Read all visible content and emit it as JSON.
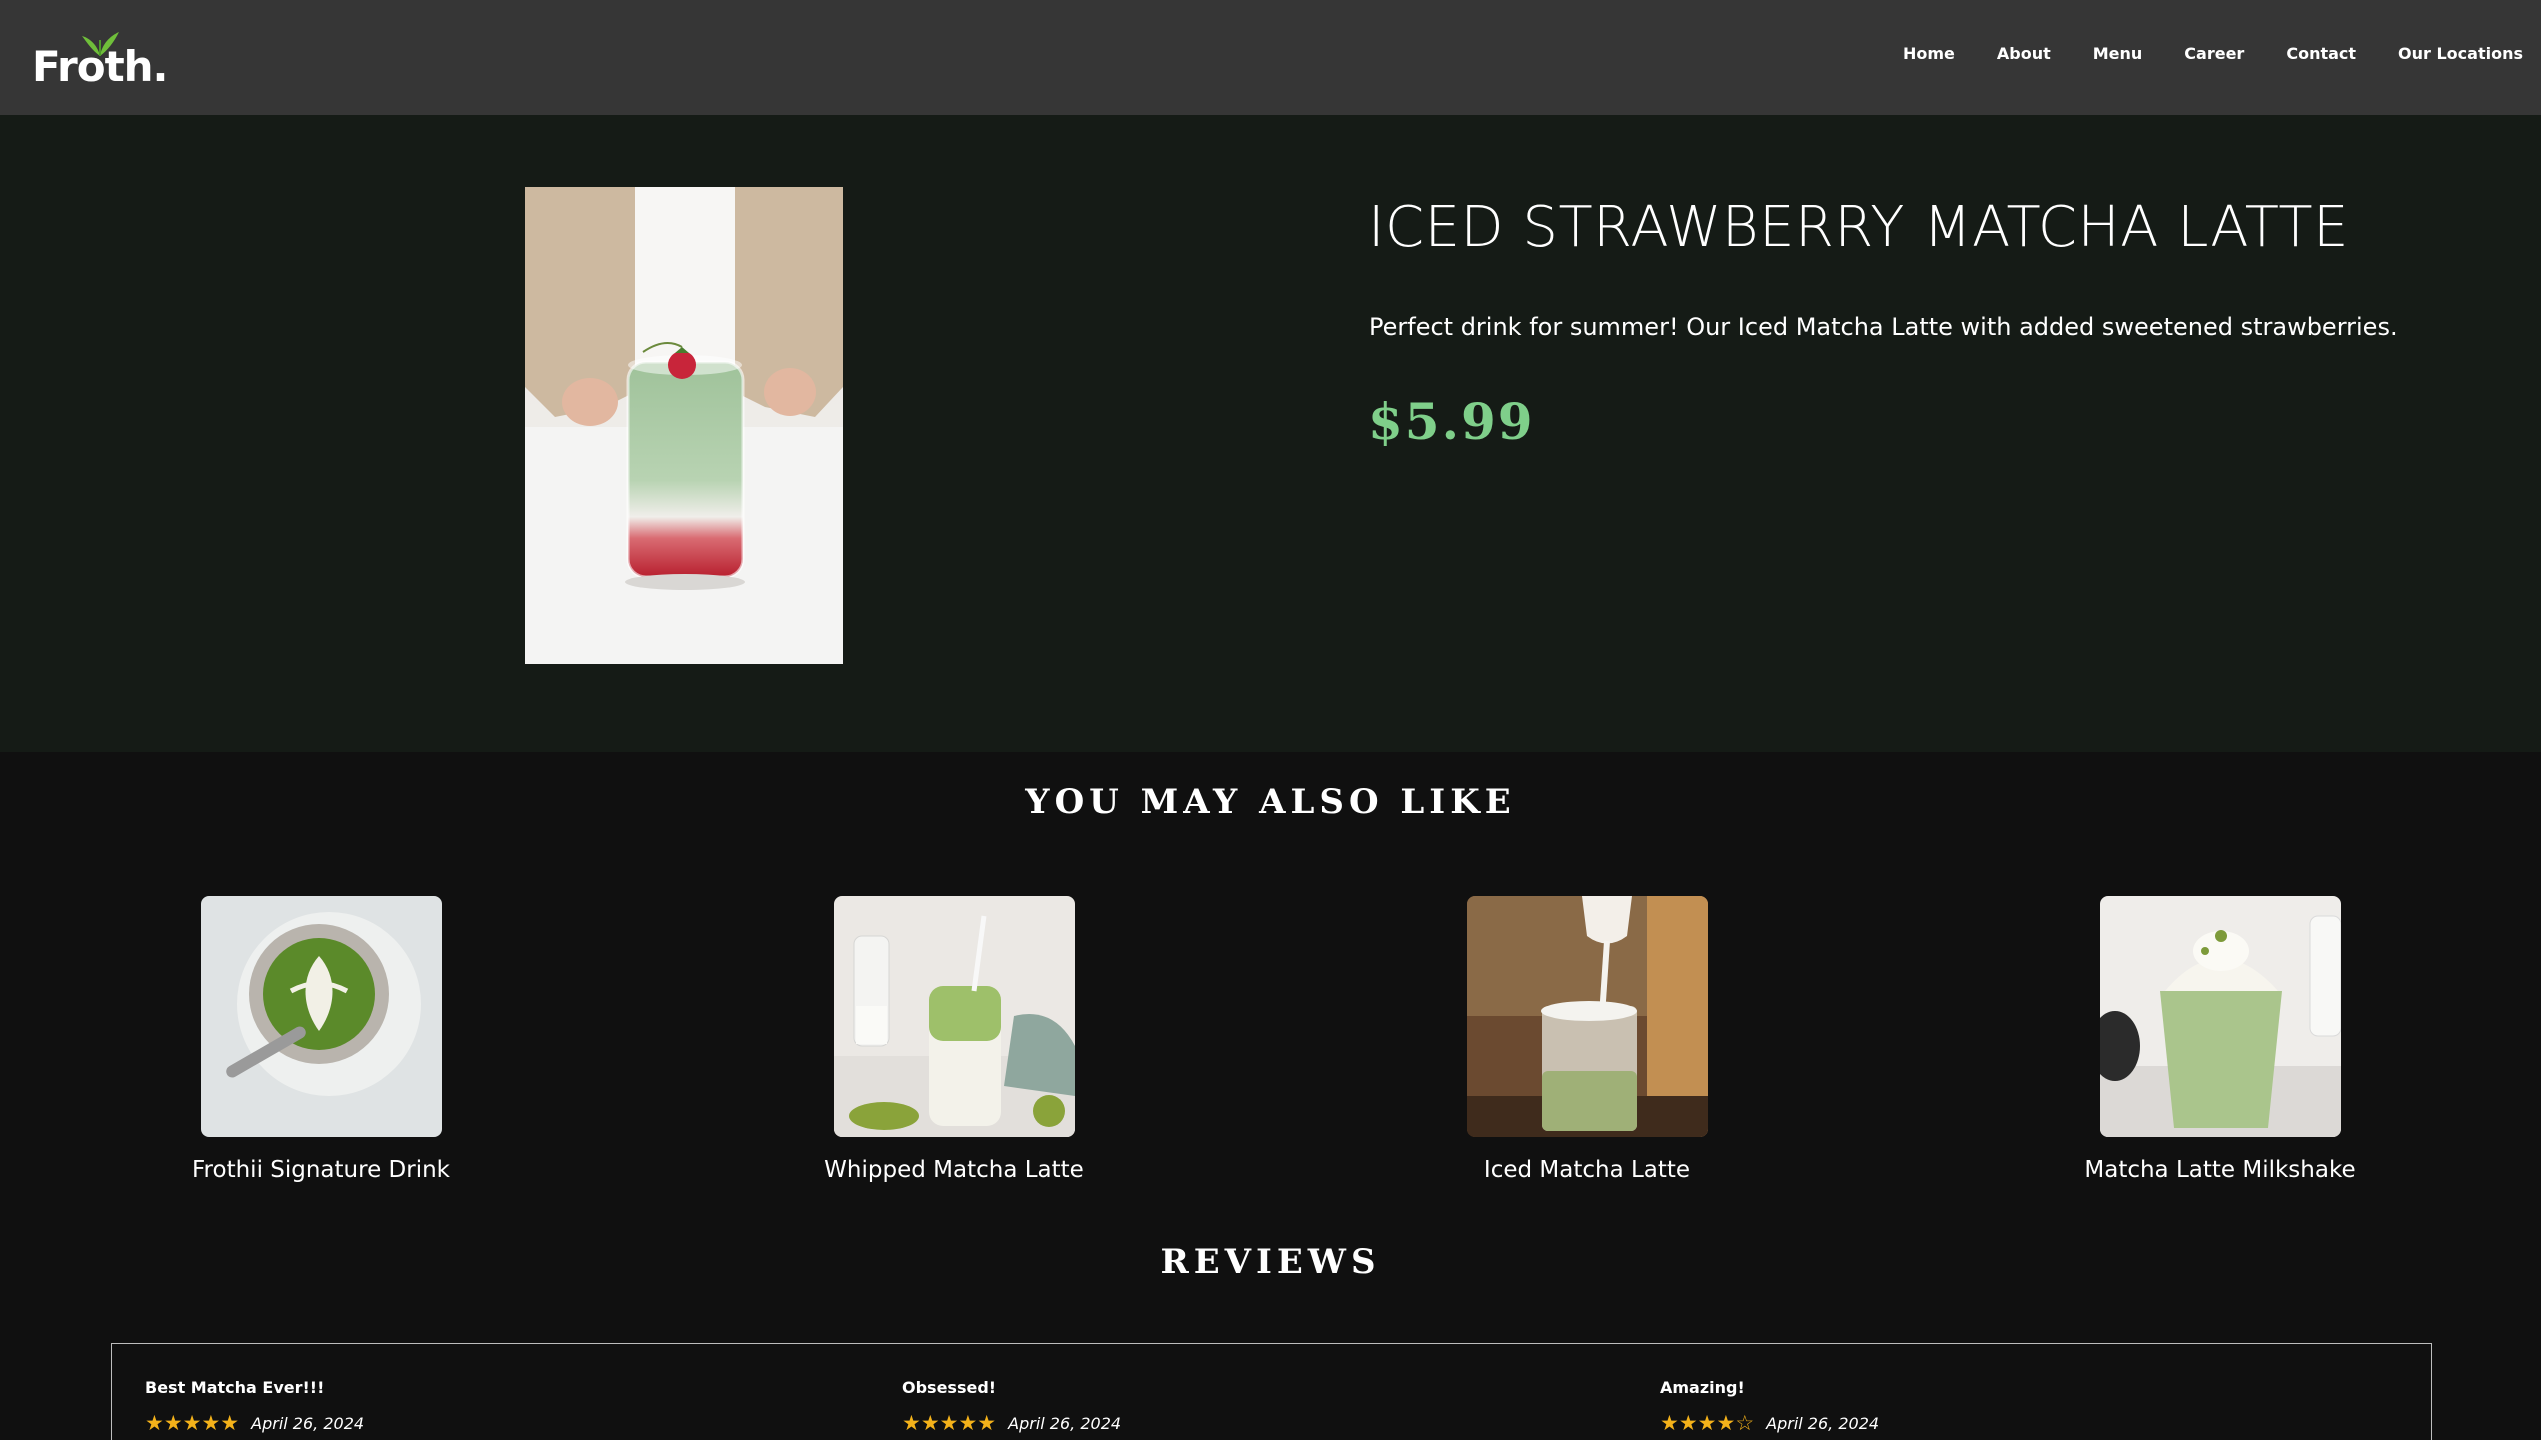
{
  "header": {
    "logo_text": "Froth.",
    "nav": [
      "Home",
      "About",
      "Menu",
      "Career",
      "Contact",
      "Our Locations"
    ]
  },
  "product": {
    "title": "ICED STRAWBERRY MATCHA LATTE",
    "description": "Perfect drink for summer! Our Iced Matcha Latte with added sweetened strawberries.",
    "price": "$5.99"
  },
  "related": {
    "heading": "YOU MAY ALSO LIKE",
    "items": [
      {
        "name": "Frothii Signature Drink"
      },
      {
        "name": "Whipped Matcha Latte"
      },
      {
        "name": "Iced Matcha Latte"
      },
      {
        "name": "Matcha Latte Milkshake"
      }
    ]
  },
  "reviews": {
    "heading": "REVIEWS",
    "items": [
      {
        "title": "Best Matcha Ever!!!",
        "rating": 5,
        "date": "April 26, 2024"
      },
      {
        "title": "Obsessed!",
        "rating": 5,
        "date": "April 26, 2024"
      },
      {
        "title": "Amazing!",
        "rating": 4,
        "date": "April 26, 2024"
      }
    ]
  },
  "colors": {
    "header_bg": "#363636",
    "hero_bg": "#151b16",
    "page_bg": "#101010",
    "price": "#7fcf8a",
    "stars": "#f4b21a",
    "logo_leaf": "#6fbf3a"
  }
}
